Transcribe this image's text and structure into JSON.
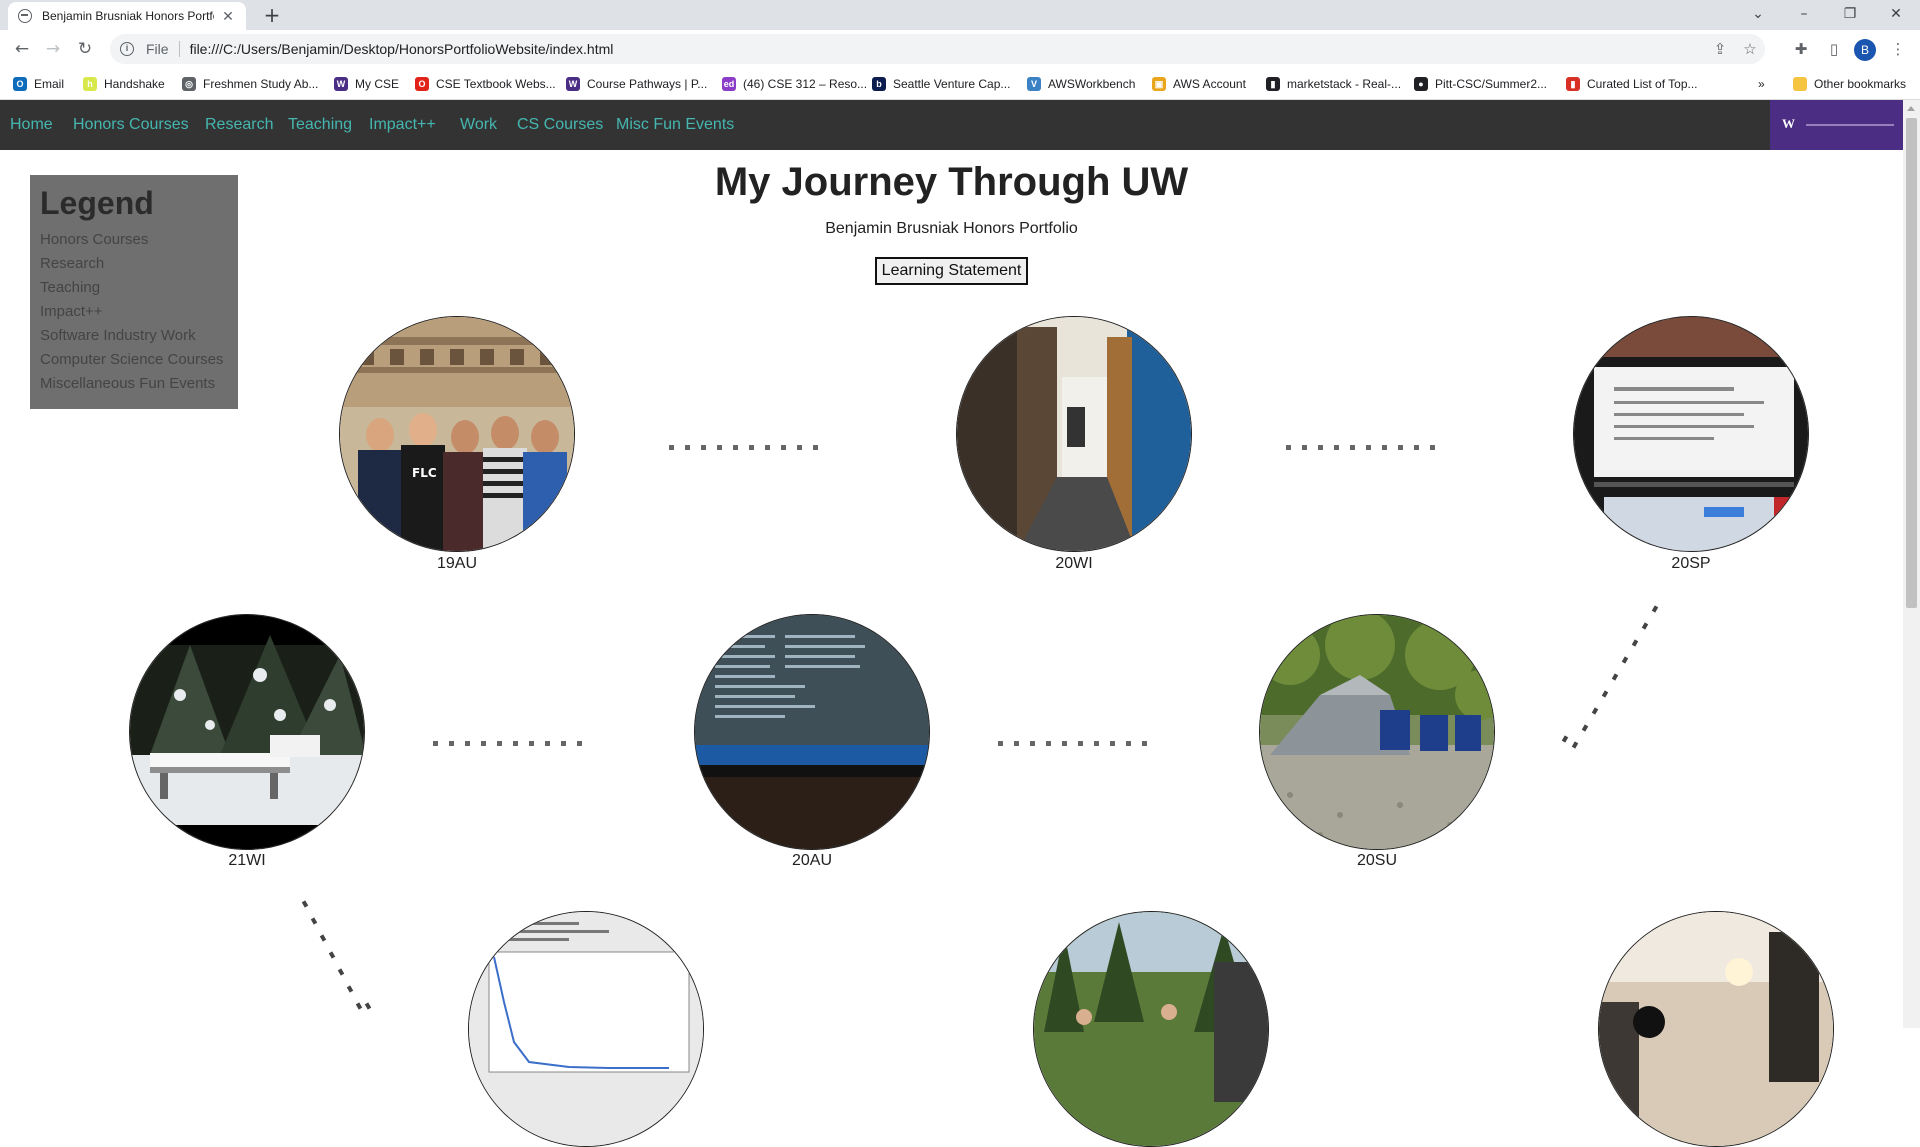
{
  "browser": {
    "tab_title": "Benjamin Brusniak Honors Portfolio",
    "scheme": "File",
    "url": "file:///C:/Users/Benjamin/Desktop/HonorsPortfolioWebsite/index.html",
    "profile_initial": "B",
    "bookmarks": [
      {
        "label": "Email",
        "icon": "outlook-icon",
        "color": "#0f6cbd"
      },
      {
        "label": "Handshake",
        "icon": "handshake-icon",
        "color": "#d6e84a"
      },
      {
        "label": "Freshmen Study Ab...",
        "icon": "globe-icon",
        "color": "#5f6368"
      },
      {
        "label": "My CSE",
        "icon": "uw-icon",
        "color": "#4b2e83"
      },
      {
        "label": "CSE Textbook Webs...",
        "icon": "opera-icon",
        "color": "#e2231a"
      },
      {
        "label": "Course Pathways | P...",
        "icon": "uw-icon",
        "color": "#4b2e83"
      },
      {
        "label": "(46) CSE 312 – Reso...",
        "icon": "ed-icon",
        "color": "#8b3cc9"
      },
      {
        "label": "Seattle Venture Cap...",
        "icon": "b-icon",
        "color": "#0b1c4d"
      },
      {
        "label": "AWSWorkbench",
        "icon": "v-icon",
        "color": "#3b82c4"
      },
      {
        "label": "AWS Account",
        "icon": "aws-box-icon",
        "color": "#e9a51c"
      },
      {
        "label": "marketstack - Real-...",
        "icon": "bar-chart-icon",
        "color": "#202124"
      },
      {
        "label": "Pitt-CSC/Summer2...",
        "icon": "github-icon",
        "color": "#202124"
      },
      {
        "label": "Curated List of Top...",
        "icon": "bookmark-red-icon",
        "color": "#d93025"
      }
    ],
    "more_bookmarks": "»",
    "other_bookmarks": "Other bookmarks"
  },
  "nav": {
    "links": [
      "Home",
      "Honors Courses",
      "Research",
      "Teaching",
      "Impact++",
      "Work",
      "CS Courses",
      "Misc Fun Events"
    ],
    "logo_letter": "W"
  },
  "legend": {
    "title": "Legend",
    "items": [
      "Honors Courses",
      "Research",
      "Teaching",
      "Impact++",
      "Software Industry Work",
      "Computer Science Courses",
      "Miscellaneous Fun Events"
    ]
  },
  "page": {
    "title": "My Journey Through UW",
    "subtitle": "Benjamin Brusniak Honors Portfolio",
    "button_label": "Learning Statement"
  },
  "timeline": {
    "quarters": [
      {
        "label": "19AU",
        "photo": "group-at-colosseum"
      },
      {
        "label": "20WI",
        "photo": "dorm-hallway"
      },
      {
        "label": "20SP",
        "photo": "laptop-screen-notes"
      },
      {
        "label": "21WI",
        "photo": "snow-covered-bench"
      },
      {
        "label": "20AU",
        "photo": "laptop-terminal"
      },
      {
        "label": "20SU",
        "photo": "campsite-tent"
      },
      {
        "label": "",
        "photo": "plot-graph"
      },
      {
        "label": "",
        "photo": "hiking-forest"
      },
      {
        "label": "",
        "photo": "indoor-room"
      }
    ]
  },
  "colors": {
    "nav_bg": "#333333",
    "nav_link": "#45b6b0",
    "uw_purple": "#4b2e83",
    "legend_bg": "#6f6f6f"
  }
}
